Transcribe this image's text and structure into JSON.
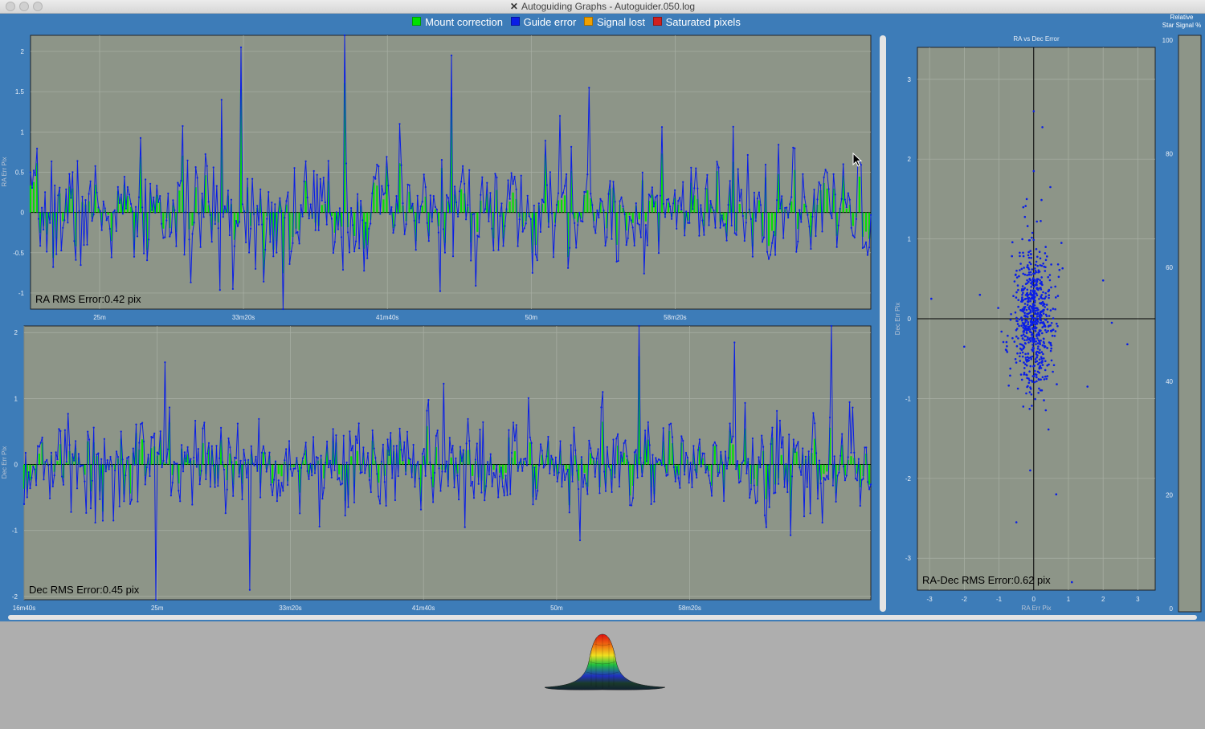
{
  "window": {
    "title": "Autoguiding Graphs - Autoguider.050.log",
    "app_icon": "x-logo-icon"
  },
  "legend": [
    {
      "label": "Mount correction",
      "color": "#00e000"
    },
    {
      "label": "Guide error",
      "color": "#0a1ee6"
    },
    {
      "label": "Signal lost",
      "color": "#f0a000"
    },
    {
      "label": "Saturated pixels",
      "color": "#d02020"
    }
  ],
  "ra_plot": {
    "ylabel": "RA Err Pix",
    "rms_label": "RA RMS Error:0.42 pix",
    "yticks": [
      "2",
      "1.5",
      "1",
      "0.5",
      "0",
      "-0.5",
      "-1"
    ],
    "xticks": [
      "25m",
      "33m20s",
      "41m40s",
      "50m",
      "58m20s"
    ]
  },
  "dec_plot": {
    "ylabel": "Dec Err Pix",
    "rms_label": "Dec RMS Error:0.45 pix",
    "yticks": [
      "2",
      "1",
      "0",
      "-1",
      "-2"
    ],
    "xticks": [
      "16m40s",
      "25m",
      "33m20s",
      "41m40s",
      "50m",
      "58m20s"
    ]
  },
  "scatter_plot": {
    "title": "RA vs Dec Error",
    "xlabel": "RA Err Pix",
    "ylabel": "Dec Err Pix",
    "rms_label": "RA-Dec RMS Error:0.62 pix",
    "xticks": [
      "-3",
      "-2",
      "-1",
      "0",
      "1",
      "2",
      "3"
    ],
    "yticks": [
      "3",
      "2",
      "1",
      "0",
      "-1",
      "-2",
      "-3"
    ]
  },
  "star_signal": {
    "title_line1": "Relative",
    "title_line2": "Star Signal %",
    "yticks": [
      "100",
      "80",
      "60",
      "40",
      "20",
      "0"
    ]
  },
  "chart_data": [
    {
      "type": "line",
      "name": "ra",
      "ylabel": "RA Err Pix",
      "ylim": [
        -1.2,
        2.2
      ],
      "xlim": [
        1260,
        4180
      ],
      "x_ticks_s": [
        1500,
        2000,
        2500,
        3000,
        3500
      ],
      "y_ticks": [
        2,
        1.5,
        1,
        0.5,
        0,
        -0.5,
        -1
      ],
      "grid": true,
      "n_samples": 520,
      "rms": 0.42,
      "seed": 7,
      "spikes": [
        {
          "t": 0.25,
          "v": 2.05
        },
        {
          "t": 0.228,
          "v": 1.4
        },
        {
          "t": 0.3,
          "v": -1.2
        },
        {
          "t": 0.374,
          "v": 2.2
        },
        {
          "t": 0.5,
          "v": 1.95
        },
        {
          "t": 0.55,
          "v": -0.2
        },
        {
          "t": 0.598,
          "v": -0.75
        },
        {
          "t": 0.665,
          "v": 1.55
        },
        {
          "t": 0.24,
          "v": -0.95
        },
        {
          "t": 0.124,
          "v": -0.55
        },
        {
          "t": 0.44,
          "v": 1.1
        },
        {
          "t": 0.63,
          "v": 1.2
        }
      ],
      "series": [
        {
          "name": "Mount correction",
          "color": "#00e000"
        },
        {
          "name": "Guide error",
          "color": "#0a1ee6"
        }
      ]
    },
    {
      "type": "line",
      "name": "dec",
      "ylabel": "Dec Err Pix",
      "ylim": [
        -2.05,
        2.1
      ],
      "xlim": [
        1000,
        4180
      ],
      "x_ticks_s": [
        1000,
        1500,
        2000,
        2500,
        3000,
        3500
      ],
      "y_ticks": [
        2,
        1,
        0,
        -1,
        -2
      ],
      "grid": true,
      "n_samples": 560,
      "rms": 0.45,
      "seed": 13,
      "spikes": [
        {
          "t": 0.155,
          "v": -2.05
        },
        {
          "t": 0.167,
          "v": 1.55
        },
        {
          "t": 0.267,
          "v": -1.9
        },
        {
          "t": 0.727,
          "v": 2.1
        },
        {
          "t": 0.684,
          "v": 1.1
        },
        {
          "t": 0.839,
          "v": 1.85
        },
        {
          "t": 0.954,
          "v": 2.1
        },
        {
          "t": 0.657,
          "v": -1.15
        },
        {
          "t": 0.52,
          "v": -0.95
        },
        {
          "t": 0.105,
          "v": -0.85
        },
        {
          "t": 0.876,
          "v": -0.95
        }
      ],
      "series": [
        {
          "name": "Mount correction",
          "color": "#00e000"
        },
        {
          "name": "Guide error",
          "color": "#0a1ee6"
        }
      ]
    },
    {
      "type": "scatter",
      "name": "ra_vs_dec",
      "title": "RA vs Dec Error",
      "xlabel": "RA Err Pix",
      "ylabel": "Dec Err Pix",
      "xlim": [
        -3.35,
        3.5
      ],
      "ylim": [
        -3.4,
        3.4
      ],
      "grid": true,
      "n_points": 640,
      "sigma_x": 0.3,
      "sigma_y": 0.45,
      "seed": 21,
      "color": "#0a1ee6",
      "outliers": [
        [
          -2.95,
          0.25
        ],
        [
          -2.0,
          -0.35
        ],
        [
          -1.55,
          0.3
        ],
        [
          0.25,
          2.4
        ],
        [
          0.0,
          2.6
        ],
        [
          0.48,
          1.65
        ],
        [
          -0.2,
          1.5
        ],
        [
          0.0,
          1.85
        ],
        [
          2.0,
          0.48
        ],
        [
          2.7,
          -0.32
        ],
        [
          0.65,
          -2.2
        ],
        [
          1.1,
          -3.3
        ],
        [
          -0.5,
          -2.55
        ],
        [
          -0.1,
          -1.9
        ],
        [
          2.25,
          -0.05
        ],
        [
          1.55,
          -0.85
        ],
        [
          -0.3,
          -1.1
        ],
        [
          0.8,
          0.95
        ]
      ]
    }
  ]
}
